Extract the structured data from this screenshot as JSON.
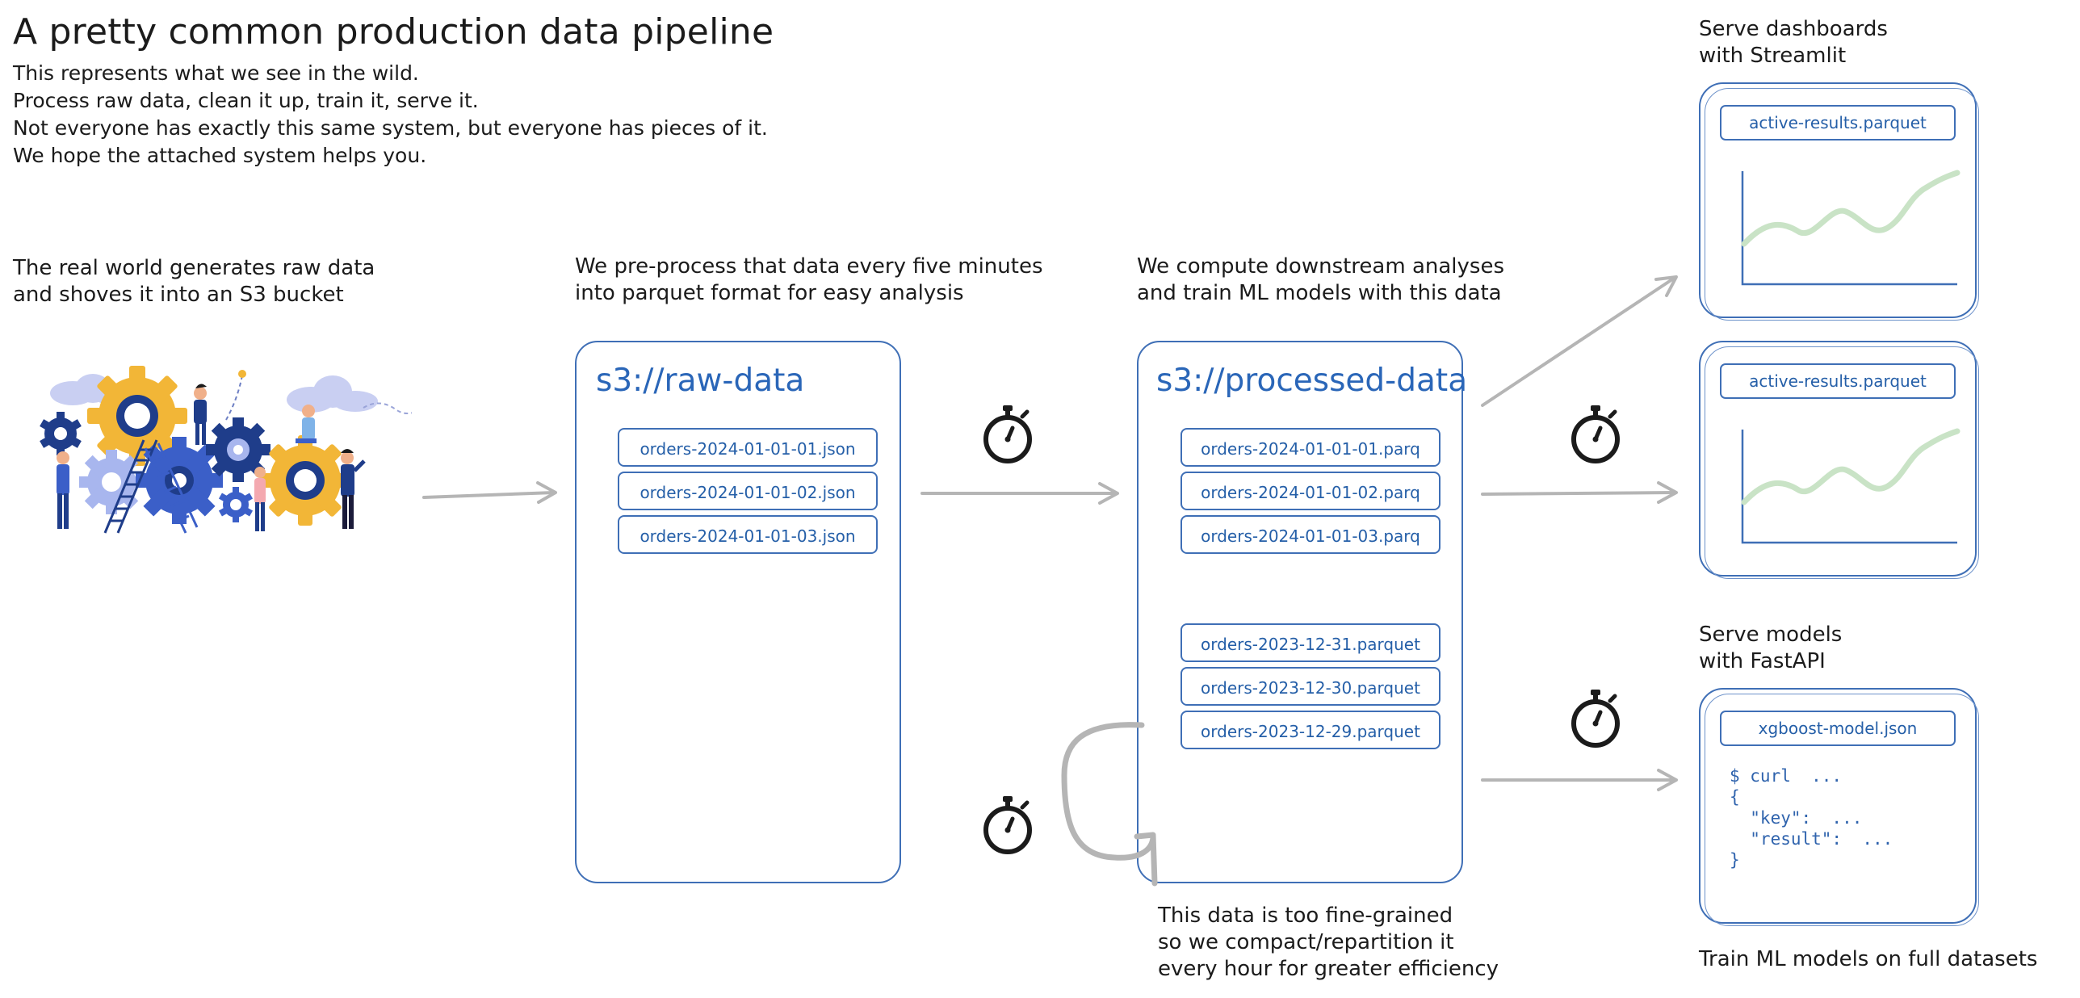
{
  "title": "A pretty common production data pipeline",
  "intro": "This represents what we see in the wild.\nProcess raw data, clean it up, train it, serve it.\nNot everyone has exactly this same system, but everyone has pieces of it.\nWe hope the attached system helps you.",
  "captions": {
    "raw_world": "The real world generates raw data\nand shoves it into an S3 bucket",
    "preprocess": "We pre-process that data every five minutes\ninto parquet format for easy analysis",
    "compute": "We compute downstream analyses\nand train ML models with this data",
    "compaction": "This data is too fine-grained\nso we compact/repartition it\nevery hour for greater efficiency",
    "dashboards": "Serve dashboards\nwith Streamlit",
    "models": "Serve models\nwith FastAPI",
    "train": "Train ML models on full datasets"
  },
  "raw_bucket": {
    "title": "s3://raw-data",
    "files": [
      "orders-2024-01-01-01.json",
      "orders-2024-01-01-02.json",
      "orders-2024-01-01-03.json"
    ]
  },
  "processed_bucket": {
    "title": "s3://processed-data",
    "recent_files": [
      "orders-2024-01-01-01.parq",
      "orders-2024-01-01-02.parq",
      "orders-2024-01-01-03.parq"
    ],
    "compacted_files": [
      "orders-2023-12-31.parquet",
      "orders-2023-12-30.parquet",
      "orders-2023-12-29.parquet"
    ]
  },
  "dashboards": [
    {
      "file": "active-results.parquet"
    },
    {
      "file": "active-results.parquet"
    }
  ],
  "model_server": {
    "file": "xgboost-model.json",
    "code": "$ curl  ...\n{\n  \"key\":  ...\n  \"result\":  ...\n}"
  },
  "colors": {
    "ink": "#1b1b1b",
    "accent_blue": "#3f6fb6",
    "arrow_gray": "#b5b5b5",
    "chart_green": "#c9e3c6",
    "gear_yellow": "#f2b637",
    "gear_navy": "#1f3d8a",
    "gear_blue": "#3b5fc8"
  },
  "icons": {
    "timer": "stopwatch-icon",
    "illustration": "people-with-gears-illustration"
  }
}
